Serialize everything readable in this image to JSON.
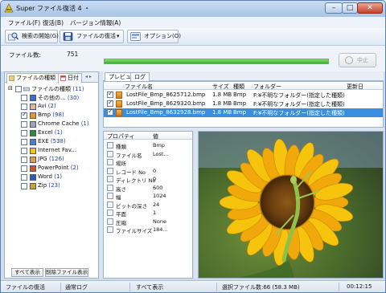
{
  "window": {
    "title": "Super ファイル復活 4 ・",
    "min_symbol": "–",
    "max_symbol": "□",
    "close_symbol": "✕"
  },
  "menu": [
    "ファイル(F)",
    "復活(B)",
    "バージョン情報(A)"
  ],
  "toolbar": {
    "scan_label": "検索の開始(G)",
    "recover_label": "ファイルの復活",
    "recover_arrow": "▾",
    "options_label": "オプション(O)"
  },
  "info": {
    "count_label": "ファイル数:",
    "count_value": "751",
    "progress": 1.0,
    "stop_label": "中止"
  },
  "left": {
    "tabs": [
      "ファイルの種類",
      "日付"
    ],
    "tab_scroll_symbol": "◂ ▸",
    "root": {
      "label": "ファイルの種類",
      "count": "(11)"
    },
    "items": [
      {
        "label": "その他の...",
        "count": "(30)",
        "checked": false,
        "icon_color": "#3a6fc9"
      },
      {
        "label": "Avi",
        "count": "(2)",
        "checked": false,
        "icon_color": "#d8b7a0"
      },
      {
        "label": "Bmp",
        "count": "(98)",
        "checked": true,
        "icon_color": "#e39a2a"
      },
      {
        "label": "Chrome Cache",
        "count": "(1)",
        "checked": false,
        "icon_color": "#9aa4b2"
      },
      {
        "label": "Excel",
        "count": "(1)",
        "checked": false,
        "icon_color": "#2f8a3a"
      },
      {
        "label": "EXE",
        "count": "(538)",
        "checked": false,
        "icon_color": "#4a7fd0"
      },
      {
        "label": "Internet Fav...",
        "count": "",
        "checked": false,
        "icon_color": "#f3c21a"
      },
      {
        "label": "JPG",
        "count": "(126)",
        "checked": false,
        "icon_color": "#e0a040"
      },
      {
        "label": "PowerPoint",
        "count": "(2)",
        "checked": false,
        "icon_color": "#d0542a"
      },
      {
        "label": "Word",
        "count": "(1)",
        "checked": false,
        "icon_color": "#2a5cb8"
      },
      {
        "label": "Zip",
        "count": "(23)",
        "checked": false,
        "icon_color": "#c9a23a"
      }
    ],
    "show_all_label": "すべて表示",
    "deleted_only_label": "削除ファイル表示"
  },
  "right": {
    "tabs": [
      "プレビュー",
      "ログ"
    ],
    "columns": [
      "ファイル名",
      "サイズ",
      "種類",
      "フォルダー",
      "更新日"
    ],
    "files": [
      {
        "name": "LostFile_Bmp_8625712.bmp",
        "size": "1.8 MB",
        "type": "Bmp",
        "folder": "F:¥不明なフォルダー(指定した種類)¥",
        "date": "",
        "selected": false
      },
      {
        "name": "LostFile_Bmp_8629320.bmp",
        "size": "1.8 MB",
        "type": "Bmp",
        "folder": "F:¥不明なフォルダー(指定した種類)¥",
        "date": "",
        "selected": false
      },
      {
        "name": "LostFile_Bmp_8632928.bmp",
        "size": "1.8 MB",
        "type": "Bmp",
        "folder": "F:¥不明なフォルダー(指定した種類)¥",
        "date": "",
        "selected": true
      }
    ],
    "prop_columns": [
      "プロパティ",
      "値"
    ],
    "properties": [
      {
        "name": "種類",
        "value": "Bmp"
      },
      {
        "name": "ファイル名",
        "value": "Lost..."
      },
      {
        "name": "場所",
        "value": ""
      },
      {
        "name": "レコード No",
        "value": "0"
      },
      {
        "name": "ディレクトリ No",
        "value": "0"
      },
      {
        "name": "高さ",
        "value": "600"
      },
      {
        "name": "幅",
        "value": "1024"
      },
      {
        "name": "ビットの深さ",
        "value": "24"
      },
      {
        "name": "平面",
        "value": "1"
      },
      {
        "name": "圧縮",
        "value": "None"
      },
      {
        "name": "ファイルサイズ",
        "value": "184..."
      }
    ]
  },
  "status": {
    "mode": "ファイルの復活",
    "log": "通常ログ",
    "view": "すべて表示",
    "selected": "選択ファイル数:66 (58.3 MB)",
    "elapsed": "00:12:15"
  }
}
